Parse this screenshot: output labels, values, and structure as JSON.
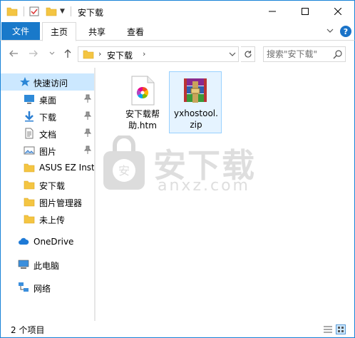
{
  "window": {
    "title": "安下载"
  },
  "ribbon": {
    "file_tab": "文件",
    "home_tab": "主页",
    "share_tab": "共享",
    "view_tab": "查看",
    "help_label": "?"
  },
  "address": {
    "crumb": "安下载",
    "search_placeholder": "搜索\"安下载\""
  },
  "navigation": {
    "quick_access": "快速访问",
    "items": [
      {
        "label": "桌面",
        "icon": "desktop-icon"
      },
      {
        "label": "下载",
        "icon": "download-icon"
      },
      {
        "label": "文档",
        "icon": "document-icon"
      },
      {
        "label": "图片",
        "icon": "pictures-icon"
      },
      {
        "label": "ASUS EZ Insta",
        "icon": "folder-icon"
      },
      {
        "label": "安下载",
        "icon": "folder-icon"
      },
      {
        "label": "图片管理器",
        "icon": "folder-icon"
      },
      {
        "label": "未上传",
        "icon": "folder-icon"
      }
    ],
    "onedrive": "OneDrive",
    "this_pc": "此电脑",
    "network": "网络"
  },
  "files": [
    {
      "name": "安下载帮助.htm",
      "line1": "安下载帮",
      "line2": "助.htm",
      "icon": "browser-file-icon"
    },
    {
      "name": "yxhostool.zip",
      "line1": "yxhostool.",
      "line2": "zip",
      "icon": "winrar-archive-icon"
    }
  ],
  "watermark": {
    "title": "安下载",
    "sub": "anxz.com"
  },
  "status": {
    "count": "2 个项目"
  },
  "colors": {
    "accent": "#1979ca",
    "selected_nav": "#cce8ff",
    "folder": "#f4c542"
  }
}
